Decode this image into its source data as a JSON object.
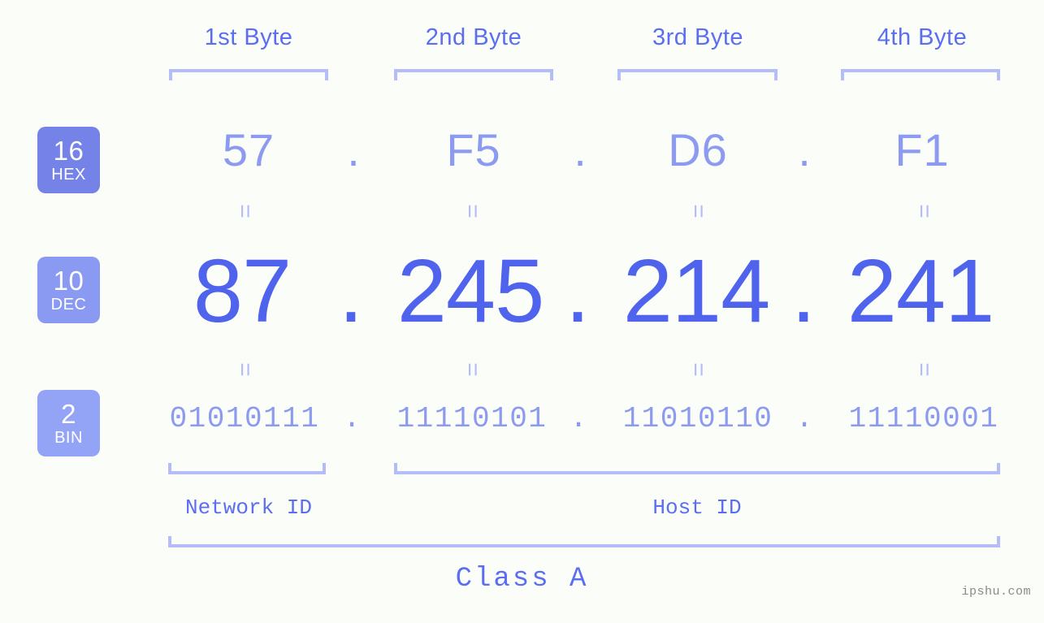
{
  "diagram": {
    "title_class": "Class A",
    "watermark": "ipshu.com",
    "byte_headers": [
      {
        "label": "1st Byte"
      },
      {
        "label": "2nd Byte"
      },
      {
        "label": "3rd Byte"
      },
      {
        "label": "4th Byte"
      }
    ],
    "rows": [
      {
        "radix": "16",
        "radix_name": "HEX",
        "badge_color": "#7583e8",
        "values": [
          "57",
          "F5",
          "D6",
          "F1"
        ],
        "separator": "."
      },
      {
        "radix": "10",
        "radix_name": "DEC",
        "badge_color": "#8a99f2",
        "values": [
          "87",
          "245",
          "214",
          "241"
        ],
        "separator": "."
      },
      {
        "radix": "2",
        "radix_name": "BIN",
        "badge_color": "#93a4f6",
        "values": [
          "01010111",
          "11110101",
          "11010110",
          "11110001"
        ],
        "separator": "."
      }
    ],
    "equivalence_symbol": "=",
    "id_sections": [
      {
        "label": "Network ID"
      },
      {
        "label": "Host ID"
      }
    ],
    "colors": {
      "background": "#fbfdf9",
      "bracket": "#b4bcfa",
      "accent_strong": "#4f63ed",
      "accent_mid": "#5b6ef0",
      "accent_light": "#8c9bf0"
    }
  }
}
